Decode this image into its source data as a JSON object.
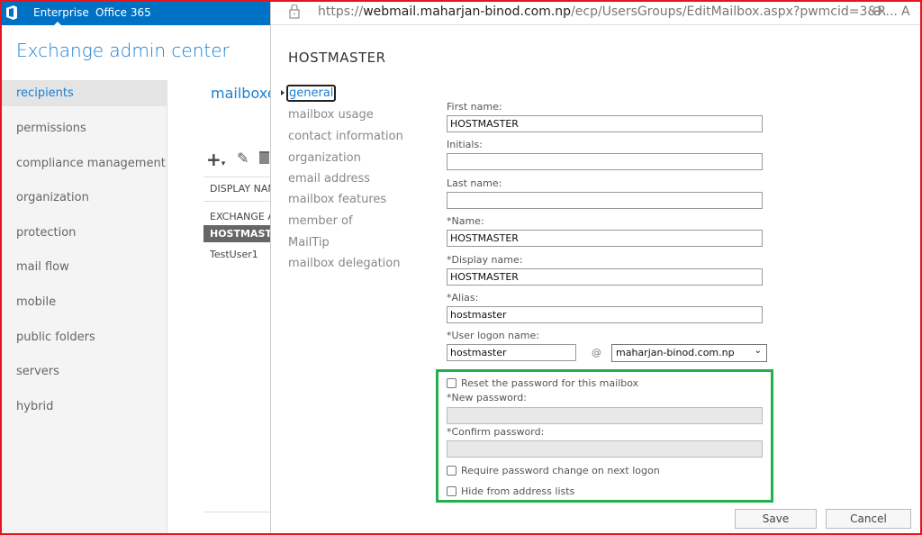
{
  "topbar": {
    "enterprise": "Enterprise",
    "office365": "Office 365"
  },
  "app_title": "Exchange admin center",
  "sidebar": {
    "items": [
      {
        "label": "recipients",
        "selected": true
      },
      {
        "label": "permissions"
      },
      {
        "label": "compliance management"
      },
      {
        "label": "organization"
      },
      {
        "label": "protection"
      },
      {
        "label": "mail flow"
      },
      {
        "label": "mobile"
      },
      {
        "label": "public folders"
      },
      {
        "label": "servers"
      },
      {
        "label": "hybrid"
      }
    ]
  },
  "main": {
    "title": "mailboxe",
    "column_header": "DISPLAY NAME",
    "rows": [
      "EXCHANGE A",
      "HOSTMASTER",
      "TestUser1"
    ],
    "selected_row": "HOSTMASTER"
  },
  "popup": {
    "url_prefix": "https://",
    "url_domain": "webmail.maharjan-binod.com.np",
    "url_path": "/ecp/UsersGroups/EditMailbox.aspx?pwmcid=3&R...",
    "zoom_letter": "A",
    "title": "HOSTMASTER",
    "nav": [
      "general",
      "mailbox usage",
      "contact information",
      "organization",
      "email address",
      "mailbox features",
      "member of",
      "MailTip",
      "mailbox delegation"
    ],
    "form": {
      "first_name_label": "First name:",
      "first_name": "HOSTMASTER",
      "initials_label": "Initials:",
      "initials": "",
      "last_name_label": "Last name:",
      "last_name": "",
      "name_label": "*Name:",
      "name": "HOSTMASTER",
      "display_name_label": "*Display name:",
      "display_name": "HOSTMASTER",
      "alias_label": "*Alias:",
      "alias": "hostmaster",
      "logon_label": "*User logon name:",
      "logon": "hostmaster",
      "at": "@",
      "domain": "maharjan-binod.com.np",
      "reset_label": "Reset the password for this mailbox",
      "reset_checked": false,
      "new_pw_label": "*New password:",
      "confirm_pw_label": "*Confirm password:",
      "require_label": "Require password change on next logon",
      "require_checked": false,
      "hide_label": "Hide from address lists",
      "hide_checked": false
    },
    "save": "Save",
    "cancel": "Cancel"
  },
  "colors": {
    "accent": "#0072c6",
    "highlight_box": "#22b04b",
    "frame": "#e8141c"
  }
}
